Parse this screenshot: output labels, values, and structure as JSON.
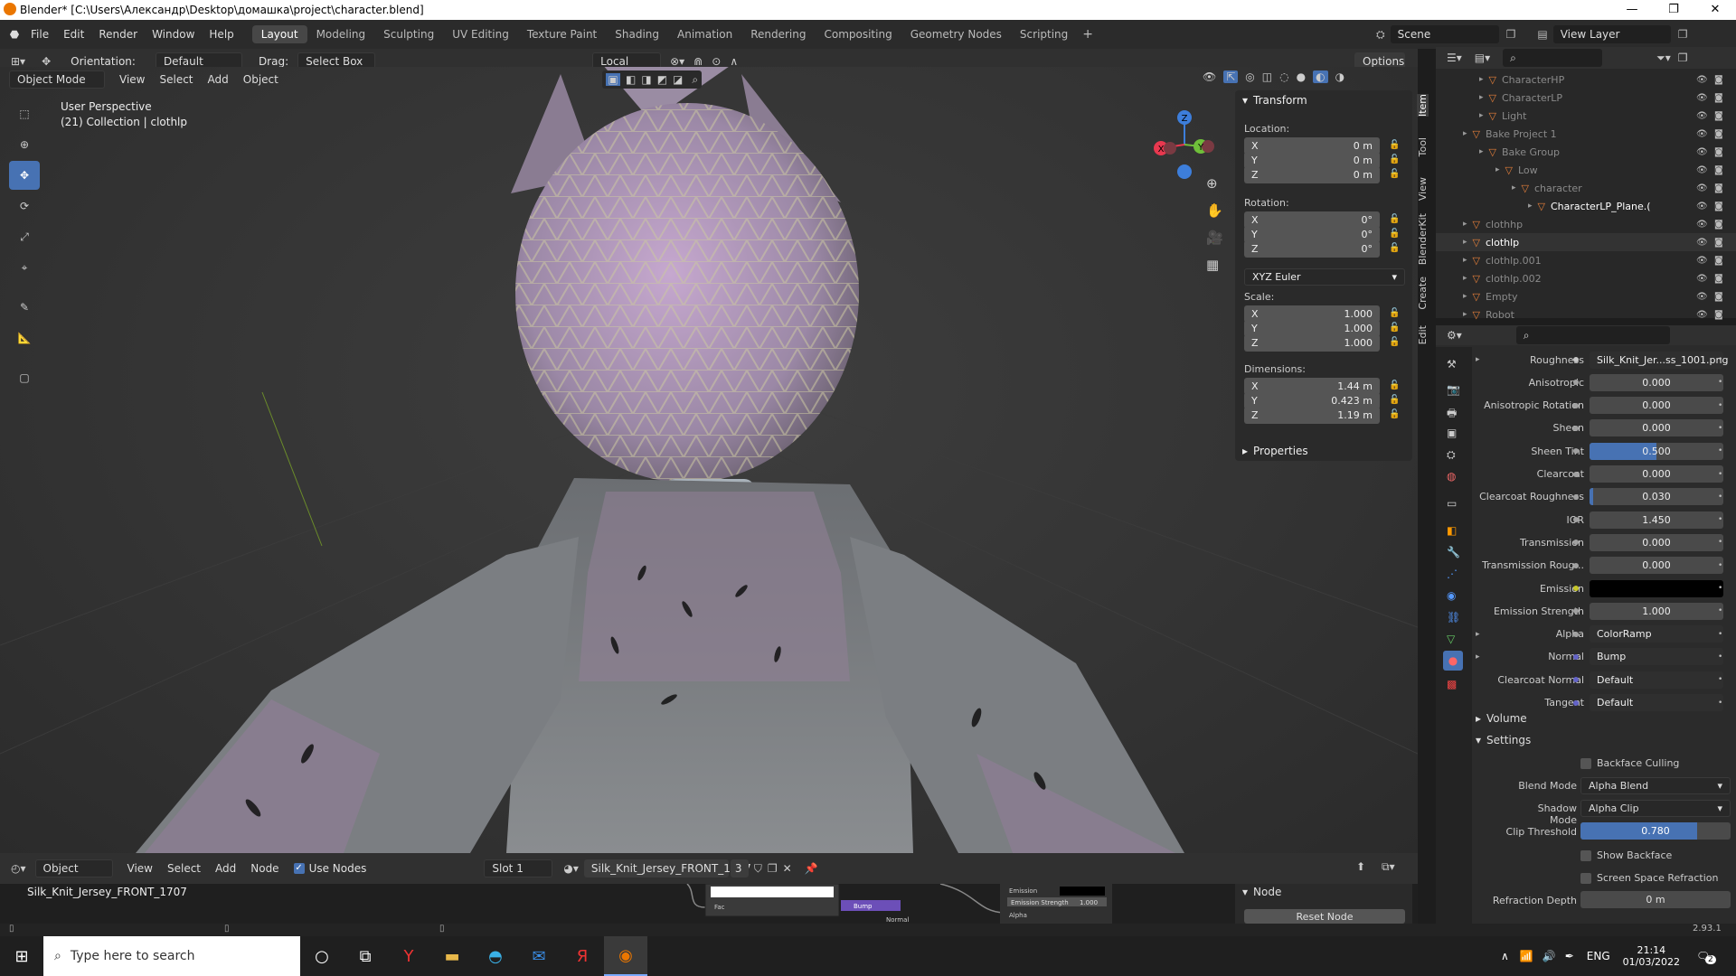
{
  "window": {
    "title": "Blender* [C:\\Users\\Александр\\Desktop\\домашка\\project\\character.blend]"
  },
  "menu": [
    "File",
    "Edit",
    "Render",
    "Window",
    "Help"
  ],
  "workspaces": [
    "Layout",
    "Modeling",
    "Sculpting",
    "UV Editing",
    "Texture Paint",
    "Shading",
    "Animation",
    "Rendering",
    "Compositing",
    "Geometry Nodes",
    "Scripting"
  ],
  "active_workspace": "Layout",
  "scene": {
    "name": "Scene",
    "view_layer": "View Layer"
  },
  "toolbar": {
    "orientation_label": "Orientation:",
    "orientation_value": "Default",
    "drag_label": "Drag:",
    "drag_value": "Select Box",
    "pivot": "Local",
    "options": "Options"
  },
  "view3d": {
    "mode": "Object Mode",
    "menus": [
      "View",
      "Select",
      "Add",
      "Object"
    ],
    "overlay_line1": "User Perspective",
    "overlay_line2": "(21) Collection | clothlp"
  },
  "gizmo": {
    "x": "X",
    "y": "Y",
    "z": "Z"
  },
  "npanel": {
    "transform_title": "Transform",
    "location_label": "Location:",
    "location": [
      "0 m",
      "0 m",
      "0 m"
    ],
    "rotation_label": "Rotation:",
    "rotation": [
      "0°",
      "0°",
      "0°"
    ],
    "rotation_mode": "XYZ Euler",
    "scale_label": "Scale:",
    "scale": [
      "1.000",
      "1.000",
      "1.000"
    ],
    "dimensions_label": "Dimensions:",
    "dimensions": [
      "1.44 m",
      "0.423 m",
      "1.19 m"
    ],
    "axes": [
      "X",
      "Y",
      "Z"
    ],
    "properties_title": "Properties",
    "tabs": [
      "Item",
      "Tool",
      "View",
      "BlenderKit",
      "Create",
      "Edit"
    ]
  },
  "outliner": {
    "items": [
      {
        "name": "CharacterHP",
        "indent": 2,
        "dim": true
      },
      {
        "name": "CharacterLP",
        "indent": 2,
        "dim": true
      },
      {
        "name": "Light",
        "indent": 2,
        "dim": true
      },
      {
        "name": "Bake Project 1",
        "indent": 1,
        "dim": true
      },
      {
        "name": "Bake Group",
        "indent": 2,
        "dim": true
      },
      {
        "name": "Low",
        "indent": 3,
        "dim": true
      },
      {
        "name": "character",
        "indent": 4,
        "dim": true
      },
      {
        "name": "CharacterLP_Plane.(",
        "indent": 5,
        "dim": false
      },
      {
        "name": "clothhp",
        "indent": 1,
        "dim": true
      },
      {
        "name": "clothlp",
        "indent": 1,
        "dim": false
      },
      {
        "name": "clothlp.001",
        "indent": 1,
        "dim": true
      },
      {
        "name": "clothlp.002",
        "indent": 1,
        "dim": true
      },
      {
        "name": "Empty",
        "indent": 1,
        "dim": true
      },
      {
        "name": "Robot",
        "indent": 1,
        "dim": true
      }
    ]
  },
  "properties": {
    "rows": [
      {
        "label": "Roughness",
        "value": "Silk_Knit_Jer...ss_1001.png",
        "kind": "link",
        "dot": "#c8c8c8",
        "expand": true
      },
      {
        "label": "Anisotropic",
        "value": "0.000",
        "kind": "num",
        "dot": "#a1a1a1"
      },
      {
        "label": "Anisotropic Rotation",
        "value": "0.000",
        "kind": "num",
        "dot": "#a1a1a1"
      },
      {
        "label": "Sheen",
        "value": "0.000",
        "kind": "num",
        "dot": "#a1a1a1"
      },
      {
        "label": "Sheen Tint",
        "value": "0.500",
        "kind": "num",
        "dot": "#a1a1a1",
        "fill": 0.5
      },
      {
        "label": "Clearcoat",
        "value": "0.000",
        "kind": "num",
        "dot": "#a1a1a1"
      },
      {
        "label": "Clearcoat Roughness",
        "value": "0.030",
        "kind": "num",
        "dot": "#a1a1a1",
        "fill": 0.03
      },
      {
        "label": "IOR",
        "value": "1.450",
        "kind": "num",
        "dot": "#a1a1a1"
      },
      {
        "label": "Transmission",
        "value": "0.000",
        "kind": "num",
        "dot": "#a1a1a1"
      },
      {
        "label": "Transmission Roug...",
        "value": "0.000",
        "kind": "num",
        "dot": "#a1a1a1"
      },
      {
        "label": "Emission",
        "value": "",
        "kind": "color",
        "dot": "#c7c729"
      },
      {
        "label": "Emission Strength",
        "value": "1.000",
        "kind": "num",
        "dot": "#a1a1a1"
      },
      {
        "label": "Alpha",
        "value": "ColorRamp",
        "kind": "link",
        "dot": "#a1a1a1",
        "expand": true
      },
      {
        "label": "Normal",
        "value": "Bump",
        "kind": "link",
        "dot": "#6363c7",
        "expand": true
      },
      {
        "label": "Clearcoat Normal",
        "value": "Default",
        "kind": "link",
        "dot": "#6363c7"
      },
      {
        "label": "Tangent",
        "value": "Default",
        "kind": "link",
        "dot": "#6363c7"
      }
    ],
    "volume": "Volume",
    "settings": "Settings",
    "backface_culling": "Backface Culling",
    "blend_mode_label": "Blend Mode",
    "blend_mode": "Alpha Blend",
    "shadow_mode_label": "Shadow Mode",
    "shadow_mode": "Alpha Clip",
    "clip_threshold_label": "Clip Threshold",
    "clip_threshold": "0.780",
    "clip_fill": 0.78,
    "show_backface": "Show Backface",
    "screen_space_refraction": "Screen Space Refraction",
    "refraction_depth_label": "Refraction Depth",
    "refraction_depth": "0 m"
  },
  "nodeeditor": {
    "type": "Object",
    "menus": [
      "View",
      "Select",
      "Add",
      "Node"
    ],
    "use_nodes": "Use Nodes",
    "slot": "Slot 1",
    "material": "Silk_Knit_Jersey_FRONT_1707",
    "users": "3",
    "breadcrumb": "Silk_Knit_Jersey_FRONT_1707",
    "node_panel": "Node",
    "reset_node": "Reset Node",
    "node_labels": [
      "Fac",
      "Bump",
      "Normal",
      "Emission",
      "Emission Strength",
      "Alpha"
    ],
    "emission_strength_value": "1.000"
  },
  "status": {
    "version": "2.93.1"
  },
  "taskbar": {
    "search_placeholder": "Type here to search",
    "lang": "ENG",
    "time": "21:14",
    "date": "01/03/2022",
    "notif": "2"
  },
  "colors": {
    "accent": "#4772b3",
    "x_axis": "#e8384f",
    "y_axis": "#6fbf3a",
    "z_axis": "#3d7edb"
  }
}
